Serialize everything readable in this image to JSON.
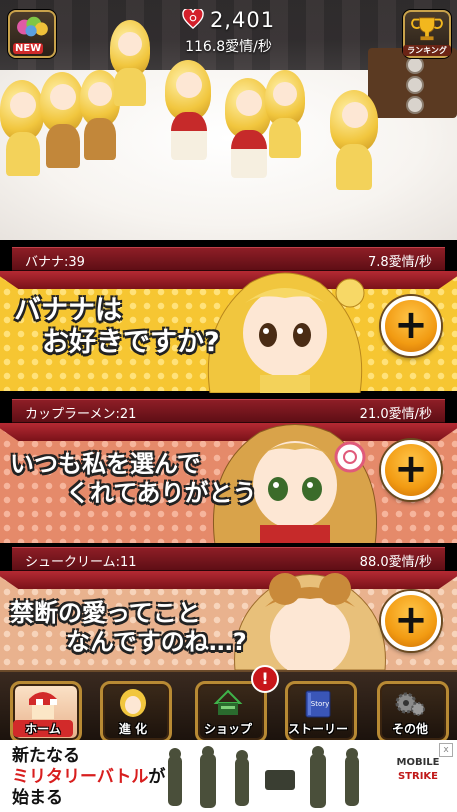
{
  "hud": {
    "total_love": "2,401",
    "rate": "116.8愛情/秒"
  },
  "top_left_button": {
    "icon": "brain-icon",
    "badge": "NEW"
  },
  "top_right_button": {
    "icon": "trophy-icon",
    "badge": "ランキング"
  },
  "items": [
    {
      "name": "バナナ:39",
      "rate": "7.8愛情/秒",
      "slogan_line1": "バナナは",
      "slogan_line2": "お好きですか?",
      "panel_color": "#f6c632",
      "dot_color": "#ffe27a"
    },
    {
      "name": "カップラーメン:21",
      "rate": "21.0愛情/秒",
      "slogan_line1": "いつも私を選んで",
      "slogan_line2": "くれてありがとう",
      "panel_color": "#e58a6a",
      "dot_color": "#f6b59c"
    },
    {
      "name": "シュークリーム:11",
      "rate": "88.0愛情/秒",
      "slogan_line1": "禁断の愛ってこと",
      "slogan_line2": "なんですのね…?",
      "panel_color": "#e9b28e",
      "dot_color": "#f7d4bb"
    }
  ],
  "nav": [
    {
      "label": "ホーム",
      "icon": "shop-awning-icon"
    },
    {
      "label": "進 化",
      "icon": "evolve-girl-icon"
    },
    {
      "label": "ショップ",
      "icon": "shop-cart-icon"
    },
    {
      "label": "ストーリー",
      "icon": "story-book-icon",
      "book_text": "Story"
    },
    {
      "label": "その他",
      "icon": "gears-icon"
    }
  ],
  "nav_alert": "!",
  "ad": {
    "line1": "新たなる",
    "line2_highlight": "ミリタリーバトル",
    "line2_rest": "が",
    "line3": "始まる",
    "logo_line1": "MOBILE",
    "logo_line2": "STRIKE",
    "close": "x"
  }
}
